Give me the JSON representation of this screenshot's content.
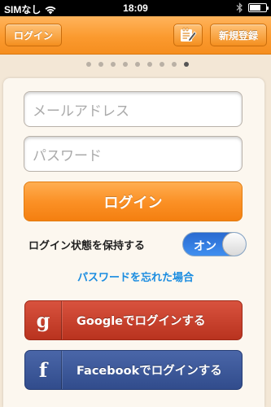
{
  "status_bar": {
    "carrier": "SIMなし",
    "time": "18:09",
    "battery_level": 0.7
  },
  "nav": {
    "login_label": "ログイン",
    "register_label": "新規登録",
    "edit_icon": "edit-note-icon"
  },
  "pager": {
    "count": 9,
    "active_index": 8
  },
  "form": {
    "email_placeholder": "メールアドレス",
    "password_placeholder": "パスワード",
    "login_button": "ログイン",
    "keep_login_label": "ログイン状態を保持する",
    "keep_login_toggle": "オン",
    "keep_login_on": true,
    "forgot_password": "パスワードを忘れた場合"
  },
  "social": {
    "google_icon": "g",
    "google_label": "Googleでログインする",
    "facebook_icon": "f",
    "facebook_label": "Facebookでログインする"
  },
  "colors": {
    "accent_orange": "#fb9126",
    "toggle_blue": "#2a6ad0",
    "link_blue": "#1a8ce0",
    "google_red": "#c53e2a",
    "facebook_blue": "#3b5998"
  }
}
